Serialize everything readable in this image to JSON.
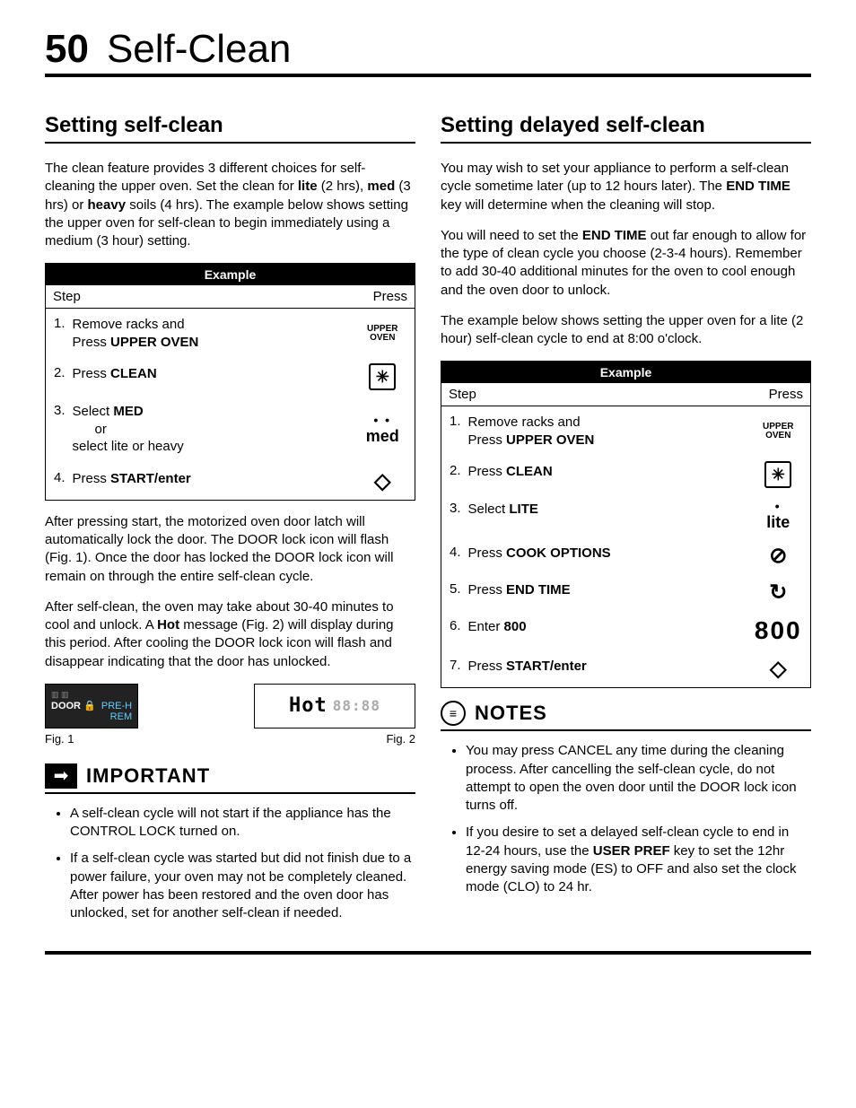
{
  "page": {
    "number": "50",
    "title": "Self-Clean"
  },
  "left": {
    "heading": "Setting self-clean",
    "intro": "The clean feature provides 3 different choices for self-cleaning the upper oven. Set the clean for lite (2 hrs), med (3 hrs) or heavy soils (4 hrs). The example below shows setting the upper oven for self-clean to begin immediately using a medium (3 hour) setting.",
    "intro_bold": {
      "lite": "lite",
      "med": "med",
      "heavy": "heavy"
    },
    "table": {
      "title": "Example",
      "col_step": "Step",
      "col_press": "Press",
      "rows": [
        {
          "num": "1.",
          "text_pre": "Remove racks and",
          "text_line2_pre": "Press ",
          "text_line2_b": "UPPER OVEN",
          "press_type": "upper"
        },
        {
          "num": "2.",
          "text_pre": "Press ",
          "text_b": "CLEAN",
          "press_type": "clean"
        },
        {
          "num": "3.",
          "text_pre": "Select ",
          "text_b": "MED",
          "text_line2": "or",
          "text_line3": "select lite or heavy",
          "press_type": "med"
        },
        {
          "num": "4.",
          "text_pre": "Press ",
          "text_b": "START/enter",
          "press_type": "start"
        }
      ]
    },
    "para_after1": "After pressing start, the motorized oven door latch will automatically lock the door. The DOOR lock icon will flash (Fig. 1). Once the door has locked the DOOR lock icon will remain on through the entire self-clean cycle.",
    "para_after2_a": "After self-clean, the oven may take about 30-40 minutes to cool and unlock.  A ",
    "para_after2_b": "Hot",
    "para_after2_c": " message (Fig. 2) will display during this period. After cooling the DOOR lock icon will flash and disappear indicating that the door has unlocked.",
    "fig1": {
      "door": "DOOR",
      "lock": "🔒",
      "preh": "PRE-H",
      "rem": "REM",
      "caption": "Fig. 1"
    },
    "fig2": {
      "hot": "Hot",
      "digits": "88:88",
      "caption": "Fig. 2"
    },
    "important": {
      "heading": "IMPORTANT",
      "items": [
        "A self-clean cycle will not start if the appliance has the CONTROL LOCK turned on.",
        "If a self-clean cycle was started but did not finish due to a power failure, your oven may not be completely cleaned. After power has been restored and the oven door has unlocked, set for another self-clean if needed."
      ]
    }
  },
  "right": {
    "heading": "Setting delayed self-clean",
    "p1_a": "You may wish to set your appliance to perform a self-clean cycle sometime later (up to 12 hours later). The ",
    "p1_b": "END TIME",
    "p1_c": " key will determine when the cleaning will stop.",
    "p2_a": "You will need to set the ",
    "p2_b": "END TIME",
    "p2_c": " out far enough to allow for the type of clean cycle you choose (2-3-4 hours). Remember to add 30-40 additional minutes for the oven to cool enough and the oven door to unlock.",
    "p3": "The example below shows setting the upper oven for a lite (2 hour) self-clean cycle to end at 8:00 o'clock.",
    "table": {
      "title": "Example",
      "col_step": "Step",
      "col_press": "Press",
      "rows": [
        {
          "num": "1.",
          "l1": "Remove racks and",
          "l2_pre": "Press ",
          "l2_b": "UPPER OVEN",
          "press_type": "upper"
        },
        {
          "num": "2.",
          "pre": "Press ",
          "b": "CLEAN",
          "press_type": "clean"
        },
        {
          "num": "3.",
          "pre": "Select ",
          "b": "LITE",
          "press_type": "lite"
        },
        {
          "num": "4.",
          "pre": "Press ",
          "b": "COOK OPTIONS",
          "press_type": "cook"
        },
        {
          "num": "5.",
          "pre": "Press ",
          "b": "END TIME",
          "press_type": "endtime"
        },
        {
          "num": "6.",
          "pre": "Enter ",
          "b": "800",
          "press_type": "800"
        },
        {
          "num": "7.",
          "pre": "Press ",
          "b": "START/enter",
          "press_type": "start"
        }
      ]
    },
    "notes": {
      "heading": "NOTES",
      "items": [
        {
          "text": "You may press CANCEL any time during the cleaning process. After cancelling the self-clean cycle, do not attempt to open the oven door until the DOOR lock icon turns off."
        },
        {
          "pre": "If you desire to set a  delayed self-clean cycle to end in 12-24 hours, use the ",
          "b": "USER PREF",
          "post": " key to set the 12hr energy saving mode (ES) to OFF and also set the clock mode (CLO) to 24 hr."
        }
      ]
    }
  },
  "icons": {
    "upper": "UPPER\nOVEN",
    "clean_glyph": "✳",
    "med_dots": "• •",
    "med_label": "med",
    "lite_dot": "•",
    "lite_label": "lite",
    "start_glyph": "◇",
    "cook_glyph": "⊘",
    "endtime_glyph": "↻",
    "num800": "800"
  }
}
